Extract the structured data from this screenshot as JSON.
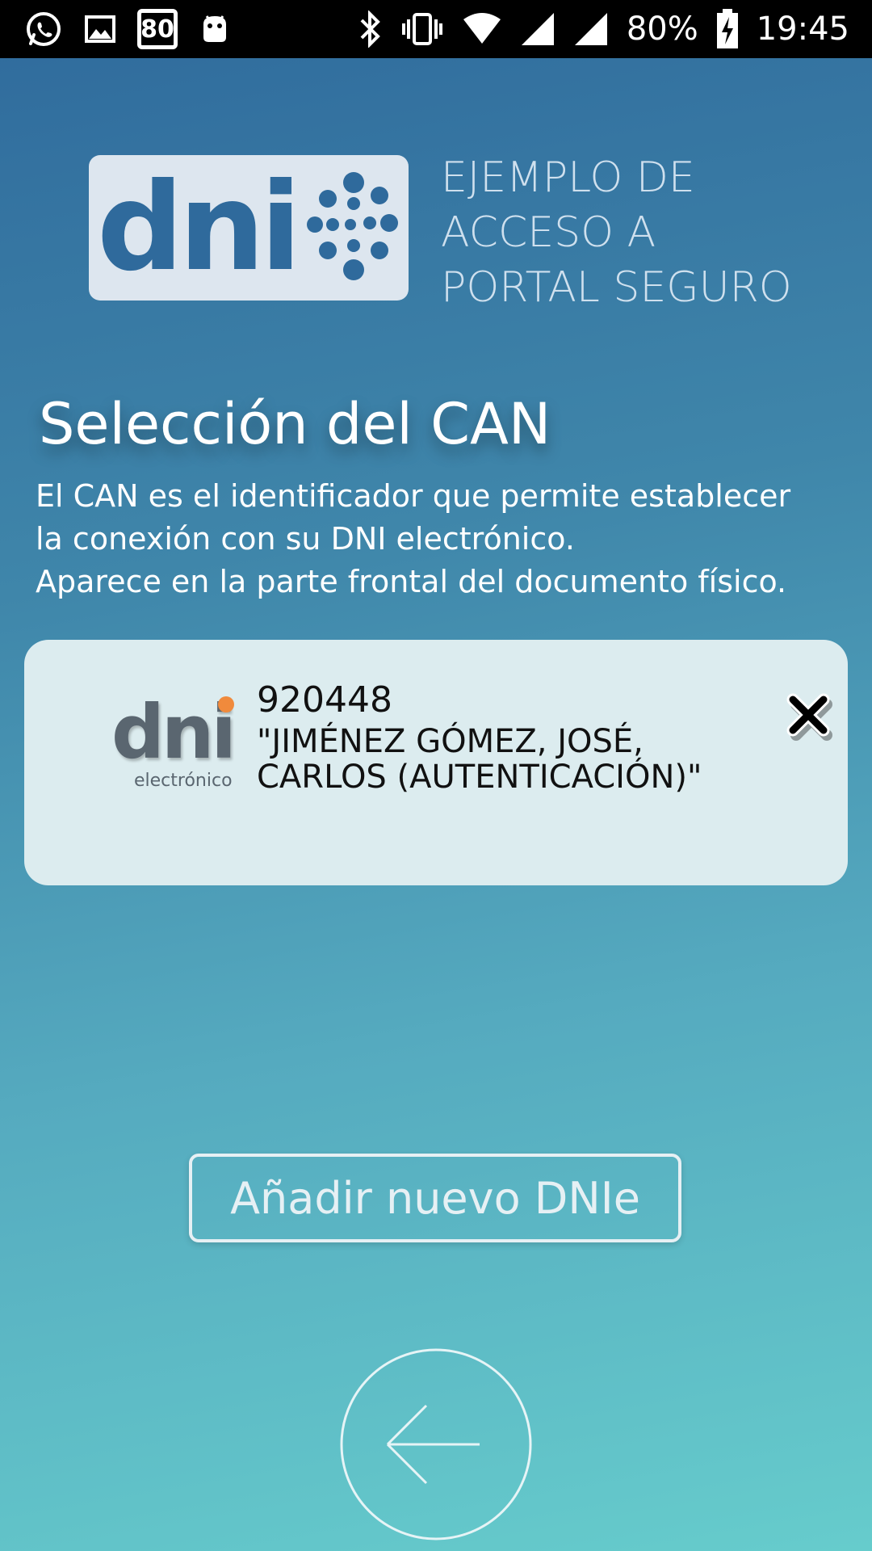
{
  "status_bar": {
    "icons": [
      "whatsapp-icon",
      "gallery-icon",
      "speed-limit-icon",
      "android-icon",
      "bluetooth-icon",
      "vibrate-icon",
      "wifi-icon",
      "signal-icon",
      "signal-icon",
      "battery-charging-icon"
    ],
    "speed_limit_badge": "80",
    "battery": "80%",
    "time": "19:45"
  },
  "header": {
    "logo_text": "dni",
    "logo_icon": "dni-dots-icon",
    "tagline_lines": [
      "EJEMPLO DE",
      "ACCESO A",
      "PORTAL SEGURO"
    ]
  },
  "section": {
    "title": "Selección del CAN",
    "description_lines": [
      "El CAN es el identificador que permite establecer",
      "la conexión con su DNI electrónico.",
      "Aparece en la parte frontal del documento físico."
    ]
  },
  "can_entries": [
    {
      "logo_text": "dni",
      "logo_subtext": "electrónico",
      "can": "920448",
      "name": "\"JIMÉNEZ GÓMEZ, JOSÉ, CARLOS (AUTENTICACIÓN)\"",
      "delete_icon": "close-icon"
    }
  ],
  "add_button": {
    "label": "Añadir nuevo DNIe"
  },
  "back_button": {
    "icon": "arrow-left-icon"
  },
  "colors": {
    "background_top": "#2f6a9c",
    "background_bottom": "#66cccc",
    "card_background": "#dcecef",
    "logo_blue": "#2f6a9c",
    "logo_orange_dot": "#f08a3c"
  }
}
